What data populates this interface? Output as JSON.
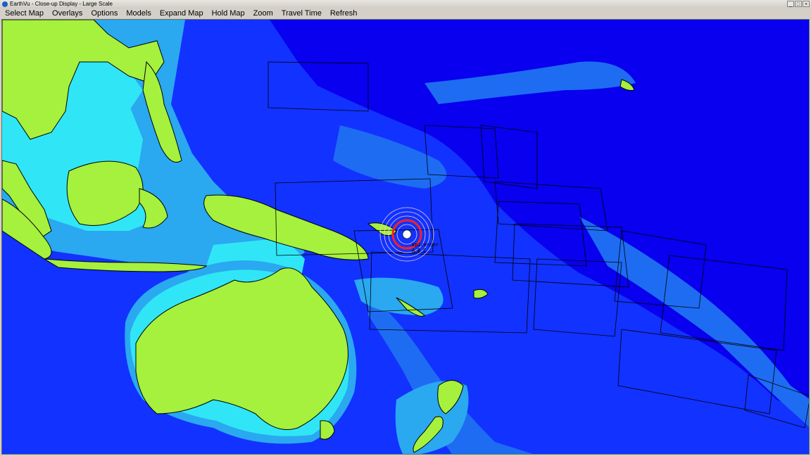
{
  "window": {
    "title": "EarthVu - Close-up Display - Large Scale",
    "controls": [
      "_",
      "□",
      "×"
    ]
  },
  "menu": {
    "items": [
      "Select Map",
      "Overlays",
      "Options",
      "Models",
      "Expand Map",
      "Hold Map",
      "Zoom",
      "Travel Time",
      "Refresh"
    ]
  },
  "map": {
    "colors": {
      "deep_ocean": "#0800ee",
      "ocean": "#1232ff",
      "mid_ocean": "#1e6cf2",
      "shelf": "#2aa8f0",
      "shallow": "#30e6f6",
      "land": "#a6f03e",
      "border": "#000000",
      "event_ring": "#ff2020"
    },
    "event_marker": {
      "label": "Epicenter",
      "stations": [
        "A",
        "B",
        "C"
      ]
    }
  }
}
